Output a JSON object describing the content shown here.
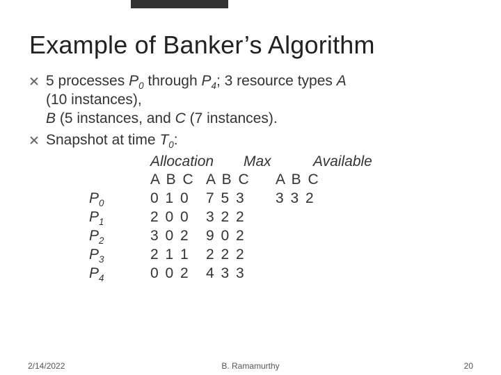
{
  "title": "Example of Banker’s Algorithm",
  "bullets": {
    "b1_line1_a": "5 processes ",
    "b1_p0": "P",
    "b1_p0s": "0",
    "b1_mid1": " through ",
    "b1_p4": "P",
    "b1_p4s": "4",
    "b1_mid2": "; 3 resource types ",
    "b1_A": "A",
    "b1_line2a": "(10 instances),",
    "b1_B": "B",
    "b1_line3a": " (5 instances, and ",
    "b1_C": "C",
    "b1_line3b": " (7 instances).",
    "b2a": "Snapshot at time ",
    "b2_T": "T",
    "b2_Ts": "0",
    "b2b": ":"
  },
  "headers": {
    "alloc": "Allocation",
    "max": "Max",
    "avail": "Available"
  },
  "abc": {
    "c1": "A B C",
    "c2": "A B C",
    "c3": "A B C"
  },
  "rows": [
    {
      "proc": "P",
      "sub": "0",
      "alloc": "0 1 0",
      "max": "7 5 3",
      "avail": "3 3 2"
    },
    {
      "proc": "P",
      "sub": "1",
      "alloc": "2 0 0",
      "max": "3 2 2",
      "avail": ""
    },
    {
      "proc": "P",
      "sub": "2",
      "alloc": "3 0 2",
      "max": "9 0 2",
      "avail": ""
    },
    {
      "proc": "P",
      "sub": "3",
      "alloc": "2 1 1",
      "max": "2 2 2",
      "avail": ""
    },
    {
      "proc": "P",
      "sub": "4",
      "alloc": "0 0 2",
      "max": "4 3 3",
      "avail": ""
    }
  ],
  "footer": {
    "date": "2/14/2022",
    "author": "B. Ramamurthy",
    "page": "20"
  },
  "chart_data": {
    "type": "table",
    "title": "Example of Banker’s Algorithm",
    "resource_types": {
      "A": 10,
      "B": 5,
      "C": 7
    },
    "processes": [
      "P0",
      "P1",
      "P2",
      "P3",
      "P4"
    ],
    "columns": [
      "Allocation",
      "Max",
      "Available"
    ],
    "sub_columns": [
      "A",
      "B",
      "C"
    ],
    "allocation": {
      "P0": [
        0,
        1,
        0
      ],
      "P1": [
        2,
        0,
        0
      ],
      "P2": [
        3,
        0,
        2
      ],
      "P3": [
        2,
        1,
        1
      ],
      "P4": [
        0,
        0,
        2
      ]
    },
    "max": {
      "P0": [
        7,
        5,
        3
      ],
      "P1": [
        3,
        2,
        2
      ],
      "P2": [
        9,
        0,
        2
      ],
      "P3": [
        2,
        2,
        2
      ],
      "P4": [
        4,
        3,
        3
      ]
    },
    "available": [
      3,
      3,
      2
    ],
    "snapshot_time": "T0"
  }
}
